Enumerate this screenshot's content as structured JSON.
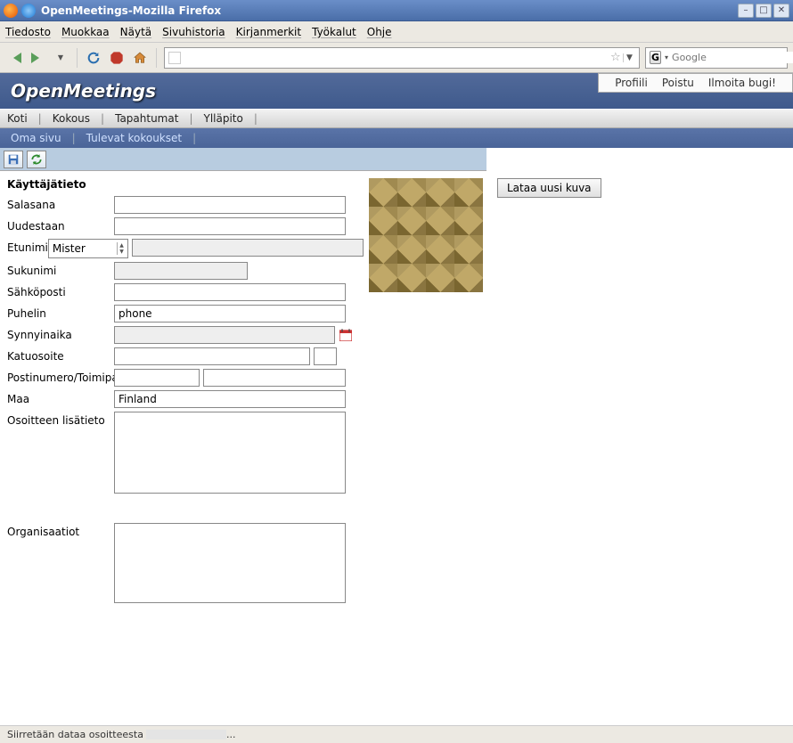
{
  "window": {
    "title": "OpenMeetings-Mozilla Firefox"
  },
  "browser_menu": {
    "file": "Tiedosto",
    "edit": "Muokkaa",
    "view": "Näytä",
    "history": "Sivuhistoria",
    "bookmarks": "Kirjanmerkit",
    "tools": "Työkalut",
    "help": "Ohje"
  },
  "urlbar": {
    "value": ""
  },
  "searchbox": {
    "placeholder": "Google"
  },
  "app": {
    "brand": "OpenMeetings",
    "top_links": {
      "profile": "Profiili",
      "logout": "Poistu",
      "bug": "Ilmoita bugi!"
    },
    "tabs_primary": {
      "home": "Koti",
      "meeting": "Kokous",
      "events": "Tapahtumat",
      "admin": "Ylläpito"
    },
    "tabs_secondary": {
      "mypage": "Oma sivu",
      "upcoming": "Tulevat kokoukset"
    }
  },
  "form": {
    "section_title": "Käyttäjätieto",
    "labels": {
      "password": "Salasana",
      "again": "Uudestaan",
      "firstname": "Etunimi",
      "lastname": "Sukunimi",
      "email": "Sähköposti",
      "phone": "Puhelin",
      "birthdate": "Synnyinaika",
      "street": "Katuosoite",
      "zip_city": "Postinumero/Toimipaikka",
      "country": "Maa",
      "extra": "Osoitteen lisätieto",
      "orgs": "Organisaatiot"
    },
    "values": {
      "title_select": "Mister",
      "firstname": "",
      "lastname": "",
      "email": "",
      "phone": "phone",
      "birthdate": "",
      "street": "",
      "street_no": "",
      "zip": "",
      "city": "",
      "country": "Finland",
      "extra": "",
      "orgs": ""
    }
  },
  "avatar": {
    "upload_label": "Lataa uusi kuva"
  },
  "status": {
    "prefix": "Siirretään dataa osoitteesta",
    "suffix": "..."
  }
}
